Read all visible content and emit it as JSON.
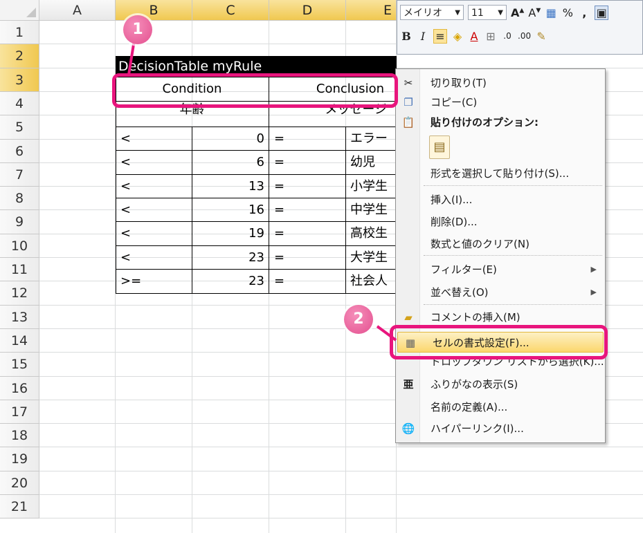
{
  "columns": [
    "A",
    "B",
    "C",
    "D",
    "E"
  ],
  "rows": [
    "1",
    "2",
    "3",
    "4",
    "5",
    "6",
    "7",
    "8",
    "9",
    "10",
    "11",
    "12",
    "13",
    "14",
    "15",
    "16",
    "17",
    "18",
    "19",
    "20",
    "21"
  ],
  "table": {
    "title": "DecisionTable myRule",
    "header_left": "Condition",
    "header_right": "Conclusion",
    "sub_left": "年齢",
    "sub_right": "メッセージ",
    "rows": [
      {
        "op": "<",
        "value": "0",
        "eq": "=",
        "msg": "エラー"
      },
      {
        "op": "<",
        "value": "6",
        "eq": "=",
        "msg": "幼児"
      },
      {
        "op": "<",
        "value": "13",
        "eq": "=",
        "msg": "小学生"
      },
      {
        "op": "<",
        "value": "16",
        "eq": "=",
        "msg": "中学生"
      },
      {
        "op": "<",
        "value": "19",
        "eq": "=",
        "msg": "高校生"
      },
      {
        "op": "<",
        "value": "23",
        "eq": "=",
        "msg": "大学生"
      },
      {
        "op": ">=",
        "value": "23",
        "eq": "=",
        "msg": "社会人"
      }
    ]
  },
  "toolbar": {
    "font_name": "メイリオ",
    "font_size": "11",
    "percent": "%",
    "comma": ","
  },
  "menu": {
    "cut": "切り取り(T)",
    "copy": "コピー(C)",
    "paste_options": "貼り付けのオプション:",
    "paste_special": "形式を選択して貼り付け(S)...",
    "insert": "挿入(I)...",
    "delete": "削除(D)...",
    "clear": "数式と値のクリア(N)",
    "filter": "フィルター(E)",
    "sort": "並べ替え(O)",
    "comment": "コメントの挿入(M)",
    "format_cells": "セルの書式設定(F)...",
    "dropdown": "ドロップダウン リストから選択(K)...",
    "phonetic": "ふりがなの表示(S)",
    "define_name": "名前の定義(A)...",
    "hyperlink": "ハイパーリンク(I)..."
  },
  "badges": {
    "one": "1",
    "two": "2"
  },
  "colors": {
    "highlight": "#e8157d",
    "badge": "#e44f8f",
    "selected_header": "#f0c850"
  }
}
